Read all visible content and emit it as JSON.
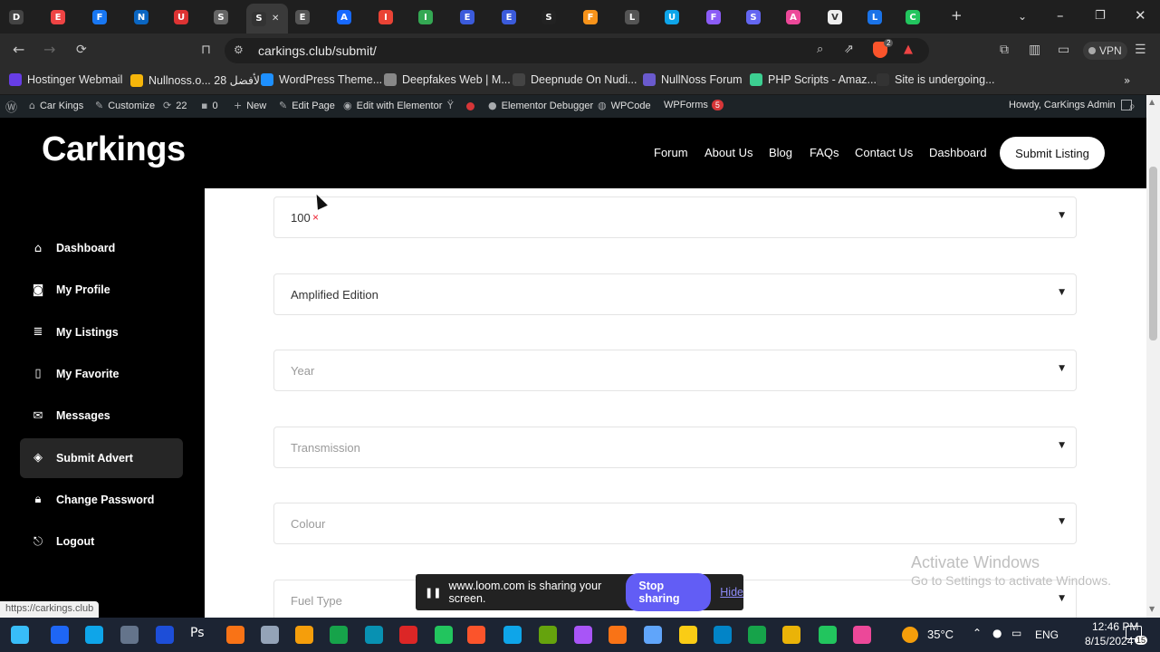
{
  "browser": {
    "tabs": [
      {
        "letter": "D",
        "color": "#444"
      },
      {
        "letter": "E",
        "color": "#e44"
      },
      {
        "letter": "F",
        "color": "#1877f2"
      },
      {
        "letter": "N",
        "color": "#0a66c2"
      },
      {
        "letter": "U",
        "color": "#d33"
      },
      {
        "letter": "S",
        "color": "#666"
      },
      {
        "letter": "S",
        "color": "#333",
        "active": true
      },
      {
        "letter": "E",
        "color": "#555"
      },
      {
        "letter": "A",
        "color": "#1769ff"
      },
      {
        "letter": "I",
        "color": "#ea4335"
      },
      {
        "letter": "I",
        "color": "#34a853"
      },
      {
        "letter": "E",
        "color": "#3b5bdb"
      },
      {
        "letter": "E",
        "color": "#3b5bdb"
      },
      {
        "letter": "S",
        "color": "#222"
      },
      {
        "letter": "F",
        "color": "#f7931a"
      },
      {
        "letter": "L",
        "color": "#555"
      },
      {
        "letter": "U",
        "color": "#0ea5e9"
      },
      {
        "letter": "F",
        "color": "#8b5cf6"
      },
      {
        "letter": "S",
        "color": "#6366f1"
      },
      {
        "letter": "A",
        "color": "#ec4899"
      },
      {
        "letter": "V",
        "color": "#eee"
      },
      {
        "letter": "L",
        "color": "#1a73e8"
      },
      {
        "letter": "C",
        "color": "#22c55e"
      }
    ],
    "url": "carkings.club/submit/",
    "vpn_label": "VPN",
    "brave_badge": "2"
  },
  "bookmarks": [
    {
      "label": "Hostinger Webmail",
      "color": "#673de6"
    },
    {
      "label": "Nullnoss.o... الأفضل 28",
      "color": "#f5b50a"
    },
    {
      "label": "WordPress Theme...",
      "color": "#1e90ff"
    },
    {
      "label": "Deepfakes Web | M...",
      "color": "#888"
    },
    {
      "label": "Deepnude On Nudi...",
      "color": "#444"
    },
    {
      "label": "NullNoss Forum",
      "color": "#6a5acd"
    },
    {
      "label": "PHP Scripts - Amaz...",
      "color": "#3ccf91"
    },
    {
      "label": "Site is undergoing...",
      "color": "#333"
    }
  ],
  "adminbar": {
    "site": "Car Kings",
    "customize": "Customize",
    "updates": "22",
    "comments": "0",
    "new": "New",
    "edit_page": "Edit Page",
    "elementor": "Edit with Elementor",
    "debugger": "Elementor Debugger",
    "wpcode": "WPCode",
    "wpforms": "WPForms",
    "wpforms_count": "5",
    "howdy": "Howdy, CarKings Admin"
  },
  "header": {
    "logo": "Carkings",
    "nav": [
      "Forum",
      "About Us",
      "Blog",
      "FAQs",
      "Contact Us",
      "Dashboard"
    ],
    "submit": "Submit Listing"
  },
  "sidebar": {
    "items": [
      {
        "label": "Dashboard",
        "icon": "home-icon"
      },
      {
        "label": "My Profile",
        "icon": "user-icon"
      },
      {
        "label": "My Listings",
        "icon": "list-icon"
      },
      {
        "label": "My Favorite",
        "icon": "bookmark-icon"
      },
      {
        "label": "Messages",
        "icon": "chat-icon"
      },
      {
        "label": "Submit Advert",
        "icon": "layers-icon",
        "active": true
      },
      {
        "label": "Change Password",
        "icon": "lock-icon"
      },
      {
        "label": "Logout",
        "icon": "logout-icon"
      }
    ]
  },
  "form": {
    "fields": [
      {
        "value": "100",
        "required_mark": "×",
        "placeholder": false
      },
      {
        "value": "Amplified Edition",
        "placeholder": false
      },
      {
        "value": "Year",
        "placeholder": true
      },
      {
        "value": "Transmission",
        "placeholder": true
      },
      {
        "value": "Colour",
        "placeholder": true
      },
      {
        "value": "Fuel Type",
        "placeholder": true
      }
    ]
  },
  "watermark": {
    "line1": "Activate Windows",
    "line2": "Go to Settings to activate Windows."
  },
  "status_url": "https://carkings.club",
  "loom": {
    "message": "www.loom.com is sharing your screen.",
    "stop": "Stop sharing",
    "hide": "Hide"
  },
  "taskbar": {
    "temperature": "35°C",
    "language": "ENG",
    "time": "12:46 PM",
    "date": "8/15/2024",
    "notifications": "15"
  }
}
